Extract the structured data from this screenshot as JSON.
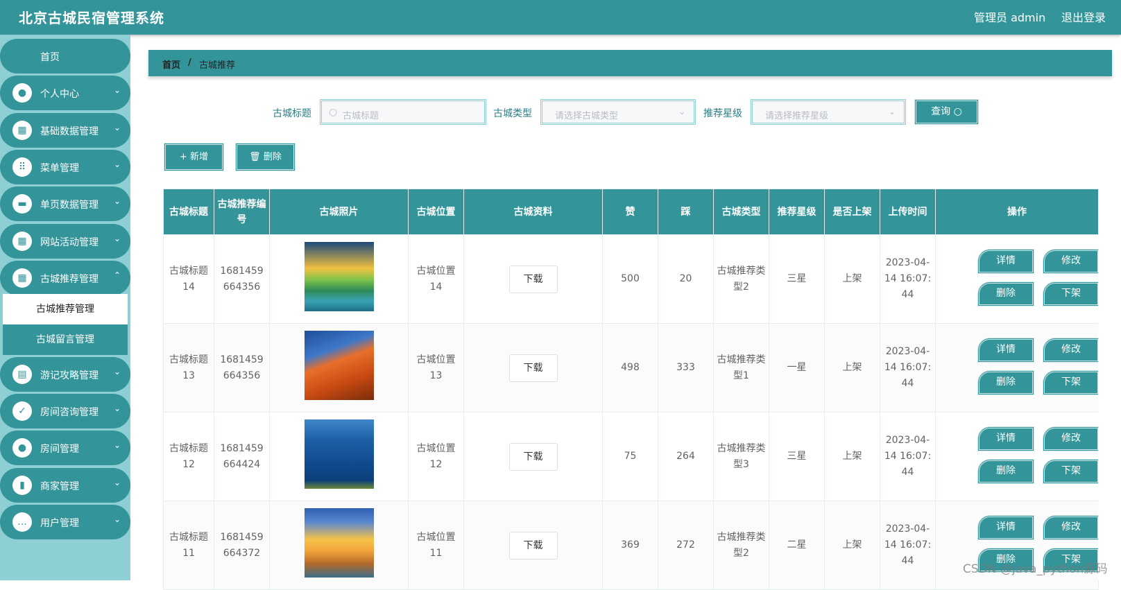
{
  "app": {
    "title": "北京古城民宿管理系统",
    "admin": "管理员 admin",
    "logout": "退出登录"
  },
  "colors": {
    "primary": "#33949a",
    "sidebar_bg": "#8ecfd3"
  },
  "sidebar": {
    "home": "首页",
    "items": [
      {
        "label": "个人中心",
        "icon": "user-icon"
      },
      {
        "label": "基础数据管理",
        "icon": "grid-icon"
      },
      {
        "label": "菜单管理",
        "icon": "apps-icon"
      },
      {
        "label": "单页数据管理",
        "icon": "briefcase-icon"
      },
      {
        "label": "网站活动管理",
        "icon": "grid-icon"
      },
      {
        "label": "古城推荐管理",
        "icon": "grid-icon"
      },
      {
        "label": "游记攻略管理",
        "icon": "clipboard-icon"
      },
      {
        "label": "房间咨询管理",
        "icon": "clipboard-check-icon"
      },
      {
        "label": "房间管理",
        "icon": "user-icon"
      },
      {
        "label": "商家管理",
        "icon": "book-icon"
      },
      {
        "label": "用户管理",
        "icon": "chat-icon"
      }
    ],
    "submenu": [
      "古城推荐管理",
      "古城留言管理"
    ]
  },
  "breadcrumb": {
    "home": "首页",
    "sep": "/",
    "current": "古城推荐"
  },
  "filters": {
    "title_label": "古城标题",
    "title_placeholder": "古城标题",
    "type_label": "古城类型",
    "type_placeholder": "请选择古城类型",
    "star_label": "推荐星级",
    "star_placeholder": "请选择推荐星级",
    "query": "查询"
  },
  "actions": {
    "add": "+ 新增",
    "delete": "删除"
  },
  "table": {
    "headers": [
      "古城标题",
      "古城推荐编号",
      "古城照片",
      "古城位置",
      "古城资料",
      "赞",
      "踩",
      "古城类型",
      "推荐星级",
      "是否上架",
      "上传时间",
      "操作"
    ],
    "download": "下载",
    "ops": [
      "详情",
      "修改",
      "删除",
      "下架"
    ],
    "rows": [
      {
        "title": "古城标题14",
        "code": "1681459664356",
        "location": "古城位置14",
        "likes": "500",
        "dislikes": "20",
        "type": "古城推荐类型2",
        "star": "三星",
        "shelf": "上架",
        "time": "2023-04-14 16:07:44",
        "photo": "sunset-lake"
      },
      {
        "title": "古城标题13",
        "code": "1681459664356",
        "location": "古城位置13",
        "likes": "498",
        "dislikes": "333",
        "type": "古城推荐类型1",
        "star": "一星",
        "shelf": "上架",
        "time": "2023-04-14 16:07:44",
        "photo": "red-rock"
      },
      {
        "title": "古城标题12",
        "code": "1681459664424",
        "location": "古城位置12",
        "likes": "75",
        "dislikes": "264",
        "type": "古城推荐类型3",
        "star": "三星",
        "shelf": "上架",
        "time": "2023-04-14 16:07:44",
        "photo": "blue-sea"
      },
      {
        "title": "古城标题11",
        "code": "1681459664372",
        "location": "古城位置11",
        "likes": "369",
        "dislikes": "272",
        "type": "古城推荐类型2",
        "star": "二星",
        "shelf": "上架",
        "time": "2023-04-14 16:07:44",
        "photo": "golden-beach"
      }
    ]
  },
  "watermark": "CSDN @java_python源码"
}
